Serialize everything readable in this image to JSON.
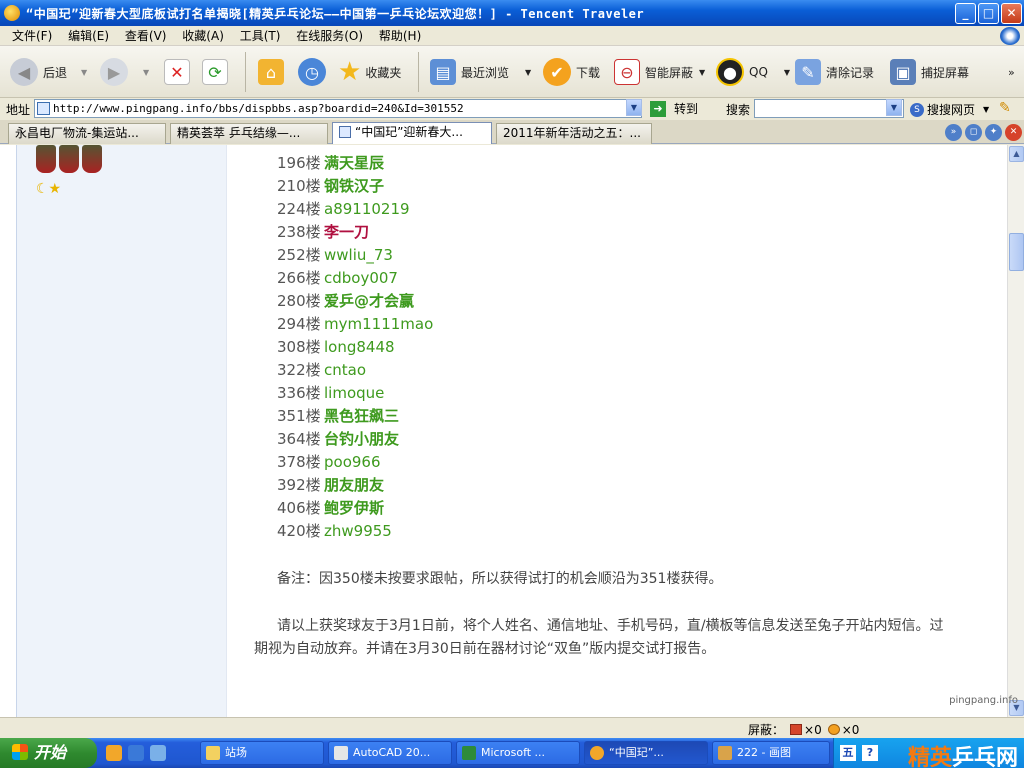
{
  "window": {
    "title": "“中国玘”迎新春大型底板试打名单揭晓[精英乒乓论坛——中国第一乒乓论坛欢迎您！] - Tencent Traveler",
    "min_label": "_",
    "max_label": "□",
    "close_label": "✕"
  },
  "menu": [
    "文件(F)",
    "编辑(E)",
    "查看(V)",
    "收藏(A)",
    "工具(T)",
    "在线服务(O)",
    "帮助(H)"
  ],
  "toolbar": {
    "back": "后退",
    "favorites": "收藏夹",
    "recent": "最近浏览",
    "download": "下载",
    "blocker": "智能屏蔽",
    "qq": "QQ",
    "clear": "清除记录",
    "capture": "捕捉屏幕"
  },
  "address": {
    "label": "地址",
    "url": "http://www.pingpang.info/bbs/dispbbs.asp?boardid=240&Id=301552",
    "go": "转到",
    "search_label": "搜索",
    "search_value": "",
    "search_engine": "搜搜网页"
  },
  "tabs": [
    "永昌电厂物流-集运站...",
    "精英荟萃 乒乓结缘—...",
    "“中国玘”迎新春大...",
    "2011年新年活动之五：..."
  ],
  "winners": [
    {
      "floor": "196楼",
      "name": "满天星辰",
      "bold": true
    },
    {
      "floor": "210楼",
      "name": "钢铁汉子",
      "bold": true
    },
    {
      "floor": "224楼",
      "name": "a89110219",
      "bold": false
    },
    {
      "floor": "238楼",
      "name": "李一刀",
      "bold": true,
      "red": true
    },
    {
      "floor": "252楼",
      "name": "wwliu_73",
      "bold": false
    },
    {
      "floor": "266楼",
      "name": "cdboy007",
      "bold": false
    },
    {
      "floor": "280楼",
      "name": "爱乒@才会赢",
      "bold": true
    },
    {
      "floor": "294楼",
      "name": "mym1111mao",
      "bold": false
    },
    {
      "floor": "308楼",
      "name": "long8448",
      "bold": false
    },
    {
      "floor": "322楼",
      "name": "cntao",
      "bold": false
    },
    {
      "floor": "336楼",
      "name": "limoque",
      "bold": false
    },
    {
      "floor": "351楼",
      "name": "黑色狂飙三",
      "bold": true
    },
    {
      "floor": "364楼",
      "name": "台钓小朋友",
      "bold": true
    },
    {
      "floor": "378楼",
      "name": "poo966",
      "bold": false
    },
    {
      "floor": "392楼",
      "name": "朋友朋友",
      "bold": true
    },
    {
      "floor": "406楼",
      "name": "鲍罗伊斯",
      "bold": true
    },
    {
      "floor": "420楼",
      "name": "zhw9955",
      "bold": false
    }
  ],
  "note": "备注：因350楼未按要求跟帖，所以获得试打的机会顺沿为351楼获得。",
  "paragraph": "请以上获奖球友于3月1日前，将个人姓名、通信地址、手机号码，直/横板等信息发送至兔子开站内短信。过期视为自动放弃。并请在3月30日前在器材讨论“双鱼”版内提交试打报告。",
  "status": {
    "blocker_label": "屏蔽：",
    "count1": "×0",
    "count2": "×0"
  },
  "watermark": "pingpang.info",
  "taskbar": {
    "start": "开始",
    "tasks": [
      "站场",
      "AutoCAD 20...",
      "Microsoft ...",
      "“中国玘”...",
      "222 - 画图"
    ],
    "tray_logo_a": "精英",
    "tray_logo_b": "乒乓网"
  }
}
